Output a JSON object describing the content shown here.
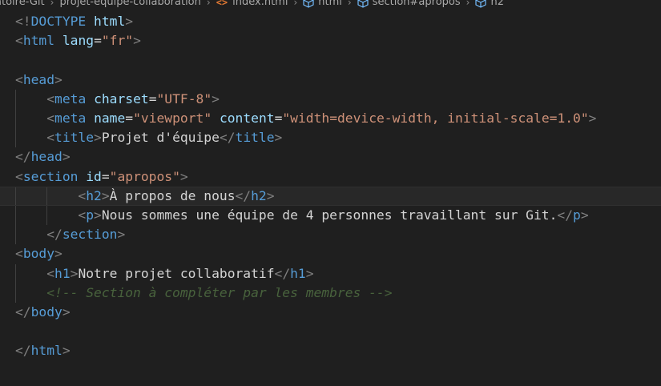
{
  "breadcrumb": {
    "items": [
      {
        "label": "atoire-Git",
        "icon": ""
      },
      {
        "label": "projet-equipe-collaboration",
        "icon": ""
      },
      {
        "label": "index.html",
        "icon": "html-file-icon"
      },
      {
        "label": "html",
        "icon": "cube-icon"
      },
      {
        "label": "section#apropos",
        "icon": "cube-icon"
      },
      {
        "label": "h2",
        "icon": "cube-icon"
      }
    ],
    "separator": "›",
    "html_icon_glyph": "<>"
  },
  "colors": {
    "background": "#1f1f1f",
    "tag": "#569cd6",
    "attribute": "#9cdcfe",
    "string": "#ce9178",
    "text": "#d4d4d4",
    "bracket": "#808080",
    "comment": "#6a9955"
  },
  "code": {
    "lines": [
      "<!DOCTYPE html>",
      "<html lang=\"fr\">",
      "",
      "<head>",
      "    <meta charset=\"UTF-8\">",
      "    <meta name=\"viewport\" content=\"width=device-width, initial-scale=1.0\">",
      "    <title>Projet d'équipe</title>",
      "</head>",
      "<section id=\"apropos\">",
      "        <h2>À propos de nous</h2>",
      "        <p>Nous sommes une équipe de 4 personnes travaillant sur Git.</p>",
      "    </section>",
      "<body>",
      "    <h1>Notre projet collaboratif</h1>",
      "    <!-- Section à compléter par les membres -->",
      "</body>",
      "",
      "</html>"
    ],
    "current_line_index": 9
  }
}
